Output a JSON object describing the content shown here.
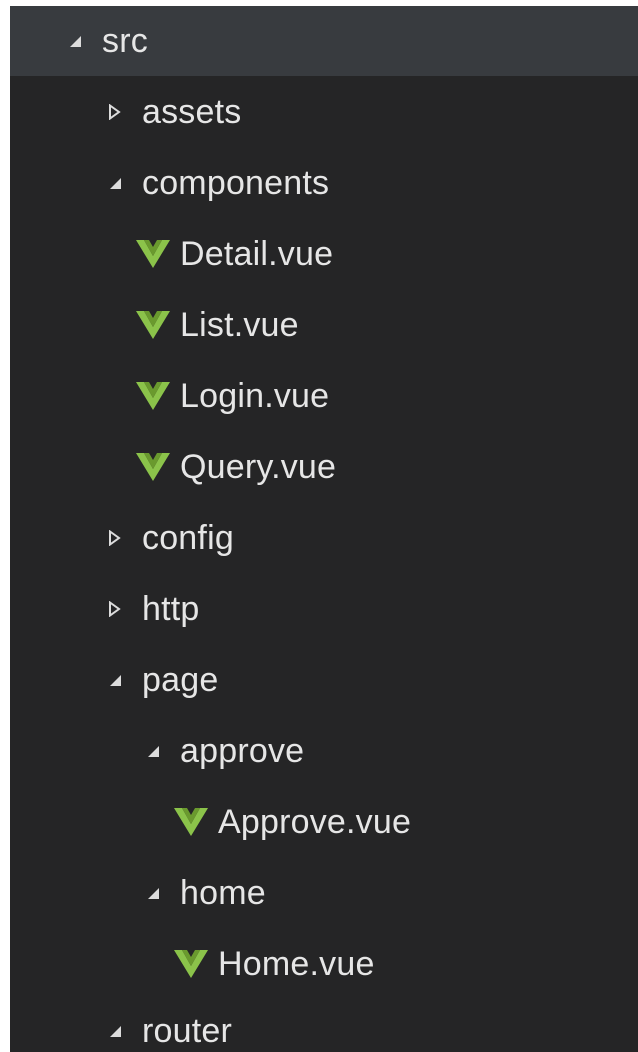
{
  "tree": [
    {
      "label": "src",
      "kind": "folder",
      "state": "expanded",
      "depth": 0,
      "selected": true
    },
    {
      "label": "assets",
      "kind": "folder",
      "state": "collapsed",
      "depth": 1
    },
    {
      "label": "components",
      "kind": "folder",
      "state": "expanded",
      "depth": 1
    },
    {
      "label": "Detail.vue",
      "kind": "file",
      "icon": "vue-icon",
      "depth": 2
    },
    {
      "label": "List.vue",
      "kind": "file",
      "icon": "vue-icon",
      "depth": 2
    },
    {
      "label": "Login.vue",
      "kind": "file",
      "icon": "vue-icon",
      "depth": 2
    },
    {
      "label": "Query.vue",
      "kind": "file",
      "icon": "vue-icon",
      "depth": 2
    },
    {
      "label": "config",
      "kind": "folder",
      "state": "collapsed",
      "depth": 1
    },
    {
      "label": "http",
      "kind": "folder",
      "state": "collapsed",
      "depth": 1
    },
    {
      "label": "page",
      "kind": "folder",
      "state": "expanded",
      "depth": 1
    },
    {
      "label": "approve",
      "kind": "folder",
      "state": "expanded",
      "depth": 2
    },
    {
      "label": "Approve.vue",
      "kind": "file",
      "icon": "vue-icon",
      "depth": 3
    },
    {
      "label": "home",
      "kind": "folder",
      "state": "expanded",
      "depth": 2
    },
    {
      "label": "Home.vue",
      "kind": "file",
      "icon": "vue-icon",
      "depth": 3
    },
    {
      "label": "router",
      "kind": "folder",
      "state": "expanded",
      "depth": 1
    }
  ],
  "colors": {
    "background": "#252526",
    "selected_row": "#383b3f",
    "text": "#e6e6e6",
    "twisty": "#dcdcdc",
    "vue_green": "#8bc34a"
  }
}
